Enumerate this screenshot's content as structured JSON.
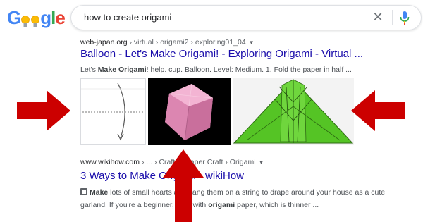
{
  "search": {
    "query": "how to create origami",
    "clear_glyph": "✕"
  },
  "logo": {
    "letters": [
      "G",
      "o",
      "g",
      "l",
      "e"
    ],
    "colors": [
      "#4285F4",
      "#EA4335",
      "#4285F4",
      "#34A853",
      "#EA4335"
    ]
  },
  "results": [
    {
      "site": "web-japan.org",
      "path": " › virtual › origami2 › exploring01_04",
      "menu": "▼",
      "title": "Balloon - Let's Make Origami! - Exploring Origami - Virtual ...",
      "snippet_pre": "Let's ",
      "snippet_bold": "Make Origami",
      "snippet_post": "! help. cup. Balloon. Level: Medium. 1. Fold the paper in half ..."
    },
    {
      "site": "www.wikihow.com",
      "path": " › ... › Crafts › Paper Craft › Origami",
      "menu": "▼",
      "title": "3 Ways to Make Origami - wikiHow",
      "line1_bold": "Make",
      "line1_post": " lots of small hearts and hang them on a string to drape around your house as a cute",
      "line2_pre": "garland. If you're a beginner, stick with ",
      "line2_bold": "origami",
      "line2_post": " paper, which is thinner ..."
    }
  ],
  "colors": {
    "link": "#1a0dab",
    "arrow": "#cc0000",
    "origami_green": "#55c425",
    "balloon_pink": "#e48fb8"
  }
}
